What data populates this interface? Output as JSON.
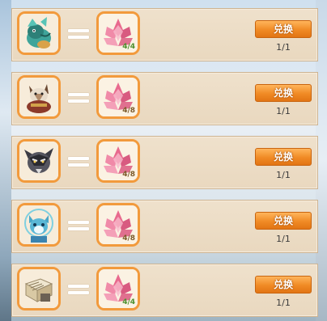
{
  "rows": [
    {
      "pet": "teal-dragon-pet-icon",
      "item": "pink-crystal-lotus-icon",
      "item_count": "4/4",
      "button_label": "兑换",
      "ratio": "1/1"
    },
    {
      "pet": "armored-wolf-pet-icon",
      "item": "pink-crystal-lotus-icon",
      "item_count": "4/8",
      "button_label": "兑换",
      "ratio": "1/1"
    },
    {
      "pet": "dark-wolf-pet-icon",
      "item": "pink-crystal-lotus-icon",
      "item_count": "4/8",
      "button_label": "兑换",
      "ratio": "1/1"
    },
    {
      "pet": "blue-fox-pet-icon",
      "item": "pink-crystal-lotus-icon",
      "item_count": "4/8",
      "button_label": "兑换",
      "ratio": "1/1"
    },
    {
      "pet": "scroll-book-icon",
      "item": "pink-crystal-lotus-icon",
      "item_count": "4/4",
      "button_label": "兑换",
      "ratio": "1/1"
    }
  ],
  "colors": {
    "accent": "#f08a25",
    "slot_border": "#f29a3c",
    "panel": "#ecdcc5",
    "count_full": "#4c8f2c"
  }
}
